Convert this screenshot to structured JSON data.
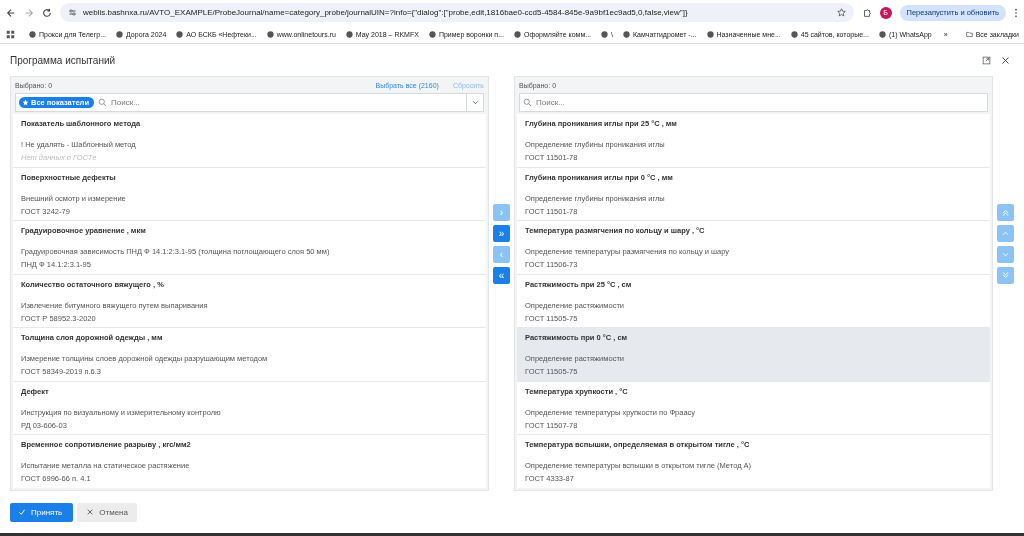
{
  "browser": {
    "url": "weblis.bashnxa.ru/AVTO_EXAMPLE/ProbeJournal/name=category_probe/journalUIN=?info={\"dialog\":[\"probe,edit,1816bae0-ccd5-4584-845e-9a9bf1ec9ad5,0,false,view\"]}",
    "profile": "Б",
    "update_button": "Перезапустить и обновить",
    "bookmarks": [
      "Прокси для Телегр...",
      "Дорога 2024",
      "АО БСКБ «Нефтеки...",
      "www.onlinetours.ru",
      "May 2018 – RKMFX",
      "Пример воронки п...",
      "Оформляйте комм...",
      "\\",
      "Камчатгидромет -...",
      "Назначенные мне...",
      "45 сайтов, которые...",
      "(1) WhatsApp"
    ],
    "more": "»",
    "all_bookmarks": "Все закладки"
  },
  "dialog": {
    "title": "Программа испытаний",
    "available": {
      "selected_count": "Выбрано: 0",
      "select_all": "Выбрать все (2160)",
      "reset": "Сбросить",
      "filter_badge": "Все показатели",
      "search_placeholder": "Поиск...",
      "items": [
        {
          "title": "Показатель шаблонного метода",
          "method": "! Не удалять - Шаблонный метод",
          "note": "Нет данных о ГОСТе",
          "selected": false
        },
        {
          "title": "Поверхностные дефекты",
          "method": "Внешний осмотр и измерение",
          "standard": "ГОСТ 3242-79",
          "selected": false
        },
        {
          "title": "Градуировочное уравнение , мкм",
          "method": "Градуировочная зависимость ПНД Ф 14.1:2:3.1-95 (толщина поглощающего слоя 50 мм)",
          "standard": "ПНД Ф 14.1:2:3.1-95",
          "selected": false
        },
        {
          "title": "Количество остаточного вяжущего , %",
          "method": "Извлечение битумного вяжущего путем выпаривания",
          "standard": "ГОСТ Р 58952.3-2020",
          "selected": false
        },
        {
          "title": "Толщина слоя дорожной одежды , мм",
          "method": "Измерение толщины слоев дорожной одежды разрушающим методом",
          "standard": "ГОСТ 58349-2019 п.6.3",
          "selected": false
        },
        {
          "title": "Дефект",
          "method": "Инструкция по визуальному и измерительному контролю",
          "standard": "РД 03-606-03",
          "selected": false
        },
        {
          "title": "Временное сопротивление разрыву , кгс/мм2",
          "method": "Испытание металла на статическое растяжение",
          "standard": "ГОСТ 6996-66 п. 4.1",
          "selected": false
        }
      ]
    },
    "transfer_buttons": [
      {
        "label": "›",
        "disabled": true
      },
      {
        "label": "»",
        "disabled": false
      },
      {
        "label": "‹",
        "disabled": true
      },
      {
        "label": "«",
        "disabled": false
      }
    ],
    "chosen": {
      "selected_count": "Выбрано: 0",
      "search_placeholder": "Поиск...",
      "items": [
        {
          "title": "Глубина проникания иглы при 25 °С , мм",
          "method": "Определение глубины проникания иглы",
          "standard": "ГОСТ 11501-78",
          "selected": false
        },
        {
          "title": "Глубина проникания иглы при 0 °С , мм",
          "method": "Определение глубины проникания иглы",
          "standard": "ГОСТ 11501-78",
          "selected": false
        },
        {
          "title": "Температура размягчения по кольцу и шару , °С",
          "method": "Определение температуры размягчения по кольцу и шару",
          "standard": "ГОСТ 11506-73",
          "selected": false
        },
        {
          "title": "Растяжимость при 25 °С , см",
          "method": "Определение растяжимости",
          "standard": "ГОСТ 11505-75",
          "selected": false
        },
        {
          "title": "Растяжимость при 0 °С , см",
          "method": "Определение растяжимости",
          "standard": "ГОСТ 11505-75",
          "selected": true
        },
        {
          "title": "Температура хрупкости , °С",
          "method": "Определение температуры хрупкости по Фраасу",
          "standard": "ГОСТ 11507-78",
          "selected": false
        },
        {
          "title": "Температура вспышки, определяемая в открытом тигле , °С",
          "method": "Определение температуры вспышки в открытом тигле (Метод А)",
          "standard": "ГОСТ 4333-87",
          "selected": false
        }
      ]
    },
    "order_buttons": [
      {
        "kind": "top",
        "disabled": true
      },
      {
        "kind": "up",
        "disabled": true
      },
      {
        "kind": "down",
        "disabled": true
      },
      {
        "kind": "bottom",
        "disabled": true
      }
    ],
    "accept": "Принять",
    "cancel": "Отмена"
  }
}
